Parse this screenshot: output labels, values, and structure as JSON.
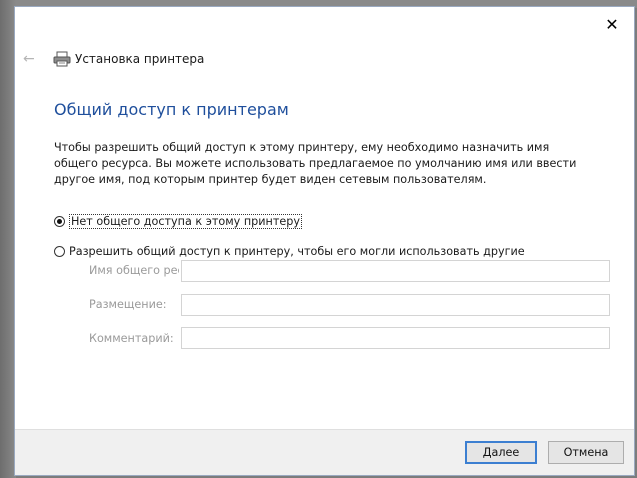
{
  "window": {
    "close_glyph": "✕",
    "back_glyph": "←",
    "title": "Установка принтера"
  },
  "main": {
    "heading": "Общий доступ к принтерам",
    "description": "Чтобы разрешить общий доступ к этому принтеру, ему необходимо назначить имя общего ресурса. Вы можете использовать предлагаемое по умолчанию имя или ввести другое имя, под которым принтер будет виден сетевым пользователям.",
    "options": [
      {
        "label": "Нет общего доступа к этому принтеру",
        "selected": true
      },
      {
        "label": "Разрешить общий доступ к принтеру, чтобы его могли использовать другие",
        "selected": false
      }
    ],
    "fields": [
      {
        "label": "Имя общего рес",
        "value": "",
        "enabled": false
      },
      {
        "label": "Размещение:",
        "value": "",
        "enabled": false
      },
      {
        "label": "Комментарий:",
        "value": "",
        "enabled": false
      }
    ]
  },
  "footer": {
    "next_label": "Далее",
    "cancel_label": "Отмена"
  },
  "colors": {
    "heading": "#1f4f9c",
    "primary_border": "#3c7fd1"
  },
  "icons": {
    "close": "close-icon",
    "back": "back-arrow-icon",
    "printer": "printer-icon"
  }
}
